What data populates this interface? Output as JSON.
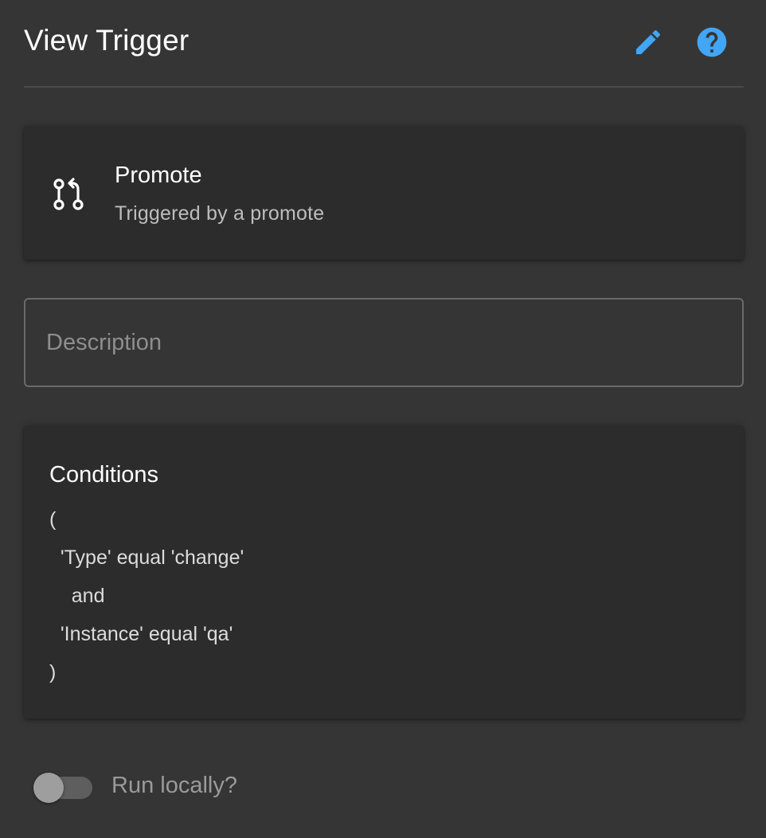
{
  "header": {
    "title": "View Trigger",
    "edit_icon": "pencil-icon",
    "help_icon": "help-circle-icon"
  },
  "trigger": {
    "icon": "source-pull-icon",
    "name": "Promote",
    "description": "Triggered by a promote"
  },
  "description_field": {
    "placeholder": "Description",
    "value": ""
  },
  "conditions": {
    "title": "Conditions",
    "lines": [
      "(",
      "  'Type' equal 'change'",
      "    and",
      "  'Instance' equal 'qa'",
      ")"
    ]
  },
  "run_locally": {
    "label": "Run locally?",
    "checked": false
  },
  "colors": {
    "background": "#353535",
    "card": "#2c2c2c",
    "accent": "#42a5f5"
  }
}
